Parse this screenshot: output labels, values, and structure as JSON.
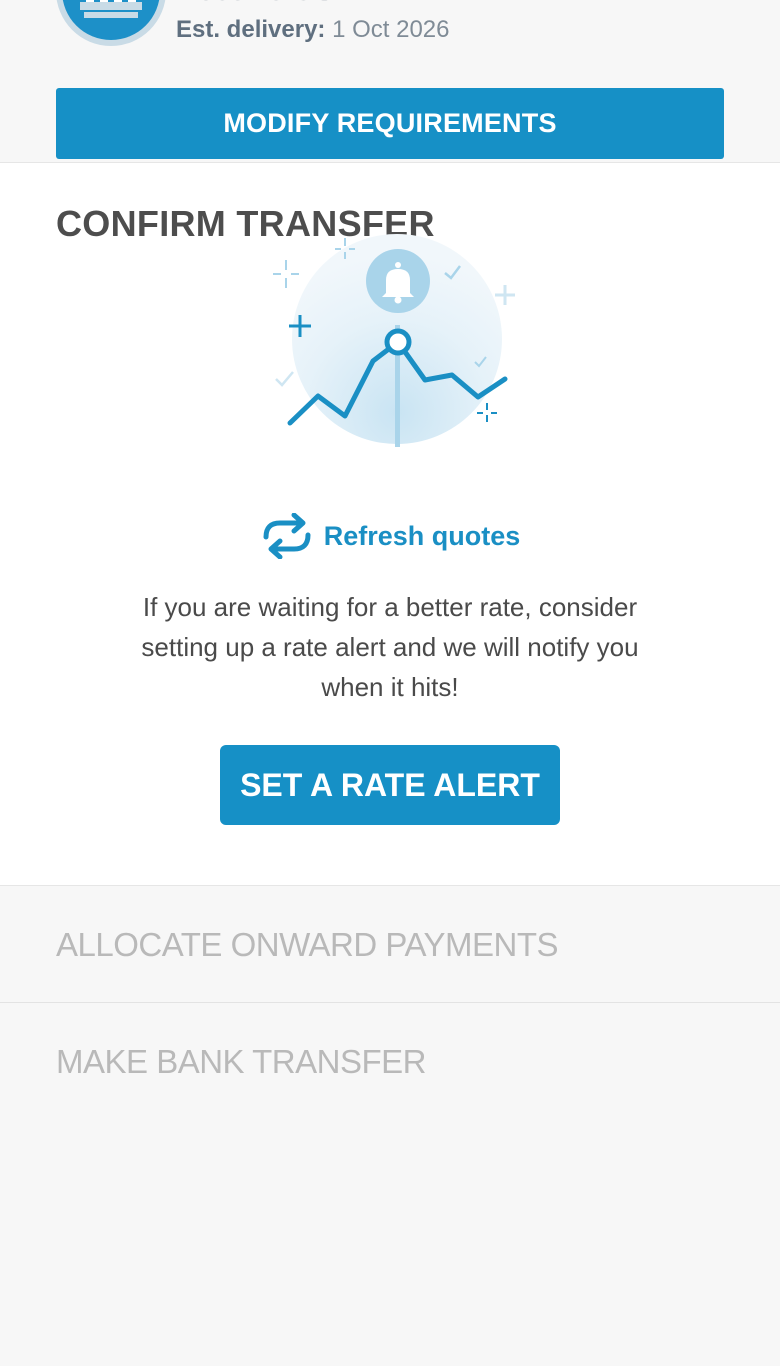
{
  "receive": {
    "title": "Receive USD",
    "est_delivery_label": "Est. delivery:",
    "est_delivery_value": "1 Oct 2026"
  },
  "modify_button": "MODIFY REQUIREMENTS",
  "confirm": {
    "title": "CONFIRM TRANSFER",
    "refresh_label": "Refresh quotes",
    "info_text": "If you are waiting for a better rate, consider setting up a rate alert and we will notify you when it hits!",
    "rate_alert_button": "SET A RATE ALERT"
  },
  "steps": {
    "onward": "ALLOCATE ONWARD PAYMENTS",
    "bank_transfer": "MAKE BANK TRANSFER"
  },
  "colors": {
    "accent": "#1690c6",
    "muted_step": "#b9b9b9",
    "background": "#f7f7f7"
  },
  "icons": [
    "bank-icon",
    "bell-icon",
    "refresh-icon"
  ]
}
